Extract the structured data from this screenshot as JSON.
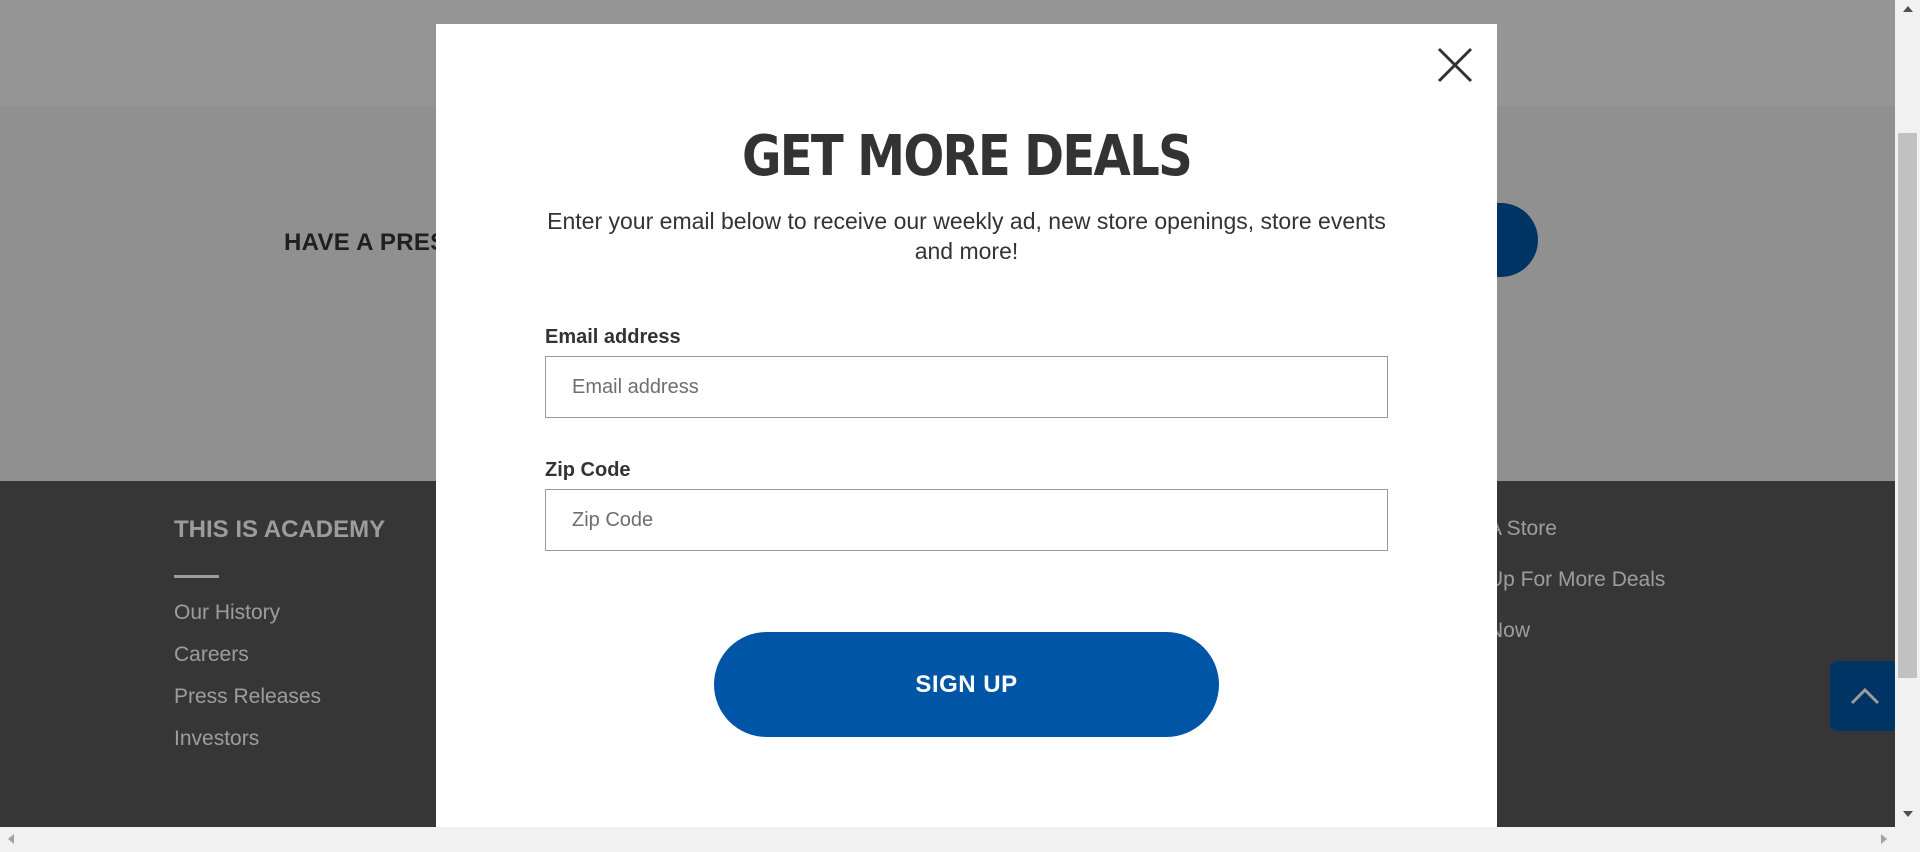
{
  "background": {
    "press_heading": "HAVE A PRES",
    "footer": {
      "column_title": "THIS IS ACADEMY",
      "left_links": [
        "Our History",
        "Careers",
        "Press Releases",
        "Investors"
      ],
      "right_links": [
        "A Store",
        "Up For More Deals",
        "Now"
      ]
    }
  },
  "modal": {
    "title": "GET MORE DEALS",
    "subtitle": "Enter your email below to receive our weekly ad, new store openings, store events and more!",
    "email_label": "Email address",
    "email_placeholder": "Email address",
    "email_value": "",
    "zip_label": "Zip Code",
    "zip_placeholder": "Zip Code",
    "zip_value": "",
    "submit_label": "SIGN UP"
  },
  "colors": {
    "accent": "#0055a6",
    "title": "#333333",
    "footer_bg": "#595959",
    "overlay": "rgba(0,0,0,0.39)"
  },
  "icons": [
    "close-icon",
    "chevron-up-icon",
    "scroll-up-arrow-icon",
    "scroll-down-arrow-icon",
    "scroll-left-arrow-icon",
    "scroll-right-arrow-icon"
  ]
}
